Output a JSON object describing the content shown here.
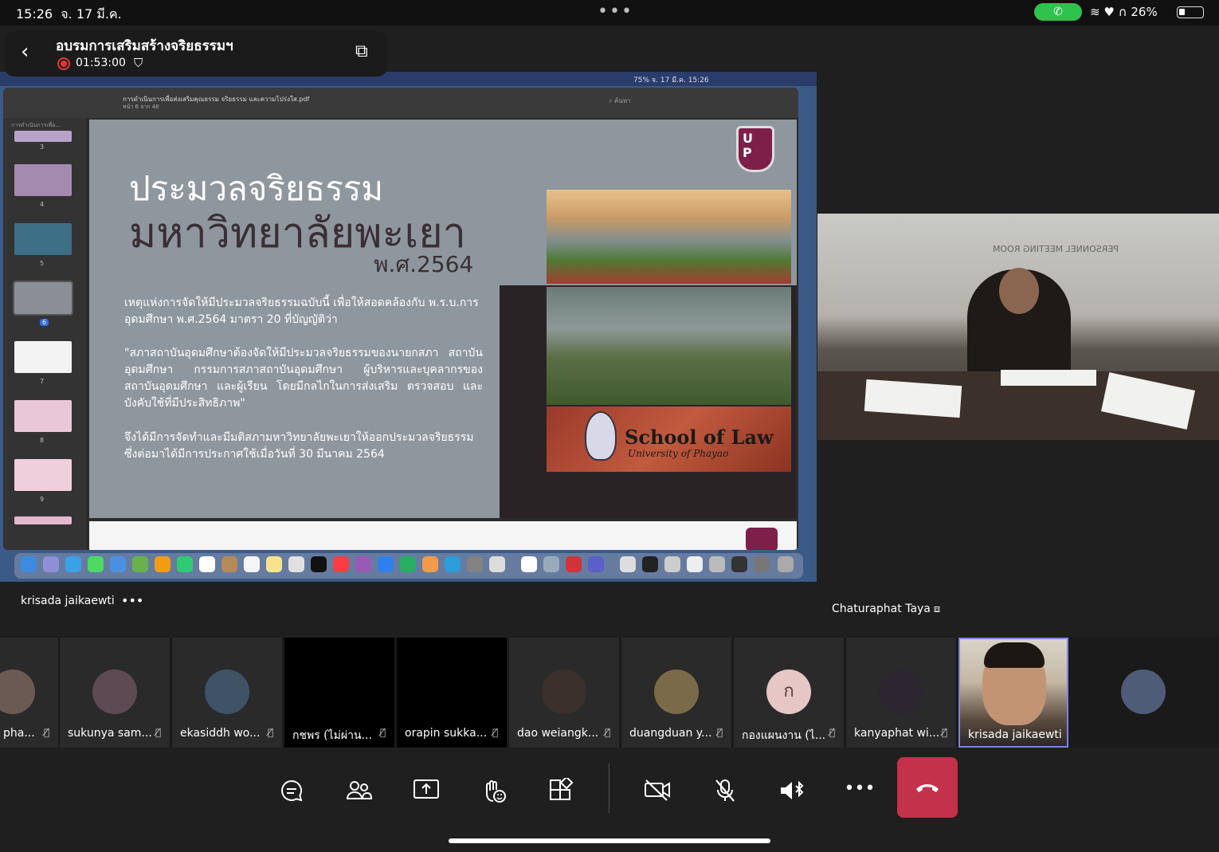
{
  "status_bar": {
    "time": "15:26",
    "date": "จ. 17 มี.ค.",
    "more": "•••",
    "call_icon": "phone-icon",
    "battery": "26%",
    "battery_level": 0.26
  },
  "meeting": {
    "title": "อบรมการเสริมสร้างจริยธรรมฯ",
    "recording_duration": "01:53:00"
  },
  "shared_screen": {
    "mac_menu_clock": "75%   จ. 17 มี.ค. 15:26",
    "pdf_filename": "การดำเนินการเพื่อส่งเสริมคุณธรรม จริยธรรม และความโปร่งใส.pdf",
    "pdf_page": "หน้า 6 จาก 48",
    "search_placeholder": "ค้นหา",
    "thumbnail_header": "การดำเนินการเพื่อ...",
    "thumb_pages": [
      "3",
      "4",
      "5",
      "6",
      "7",
      "8",
      "9"
    ],
    "selected_page": "6",
    "slide": {
      "heading_line1": "ประมวลจริยธรรม",
      "heading_line2": "มหาวิทยาลัยพะเยา",
      "heading_line3": "พ.ศ.2564",
      "paragraph1": "เหตุแห่งการจัดให้มีประมวลจริยธรรมฉบับนี้ เพื่อให้สอดคล้องกับ พ.ร.บ.การอุดมศึกษา พ.ศ.2564 มาตรา 20 ที่บัญญัติว่า",
      "paragraph2": "\"สภาสถาบันอุดมศึกษาต้องจัดให้มีประมวลจริยธรรมของนายกสภา สถาบันอุดมศึกษา กรรมการสภาสถาบันอุดมศึกษา ผู้บริหารและบุคลากรของสถาบันอุดมศึกษา และผู้เรียน โดยมีกลไกในการส่งเสริม ตรวจสอบ และบังคับใช้ที่มีประสิทธิภาพ\"",
      "paragraph3": "จึงได้มีการจัดทำและมีมติสภามหาวิทยาลัยพะเยาให้ออกประมวลจริยธรรม ซึ่งต่อมาได้มีการประกาศใช้เมื่อวันที่ 30 มีนาคม 2564",
      "school_name": "School of Law",
      "university": "University of Phayao"
    }
  },
  "presenter_name": "krisada jaikaewti",
  "main_video": {
    "name": "Chaturaphat Taya",
    "sign_text": "PERSONNEL MEETING ROOM"
  },
  "participants": [
    {
      "name": "pha...",
      "avatar_color": "#6b5a54"
    },
    {
      "name": "sukunya sam...",
      "avatar_color": "#5d4a52"
    },
    {
      "name": "ekasiddh wo...",
      "avatar_color": "#3f5266"
    },
    {
      "name": "กชพร (ไม่ผ่าน...",
      "avatar_color": ""
    },
    {
      "name": "orapin sukka...",
      "avatar_color": ""
    },
    {
      "name": "dao weiangk...",
      "avatar_color": "#3b2f2b"
    },
    {
      "name": "duangduan y...",
      "avatar_color": "#7a6a4a"
    },
    {
      "name": "กองแผนงาน (ไ...",
      "avatar_color": "#e7c6c6",
      "initial": "ก"
    },
    {
      "name": "kanyaphat wi...",
      "avatar_color": "#2b2630"
    }
  ],
  "self": {
    "name": "krisada jaikaewti"
  },
  "extra_participant_color": "#4f5c78",
  "colors": {
    "leave": "#c4314b",
    "active_border": "#7b83eb",
    "record": "#e53935",
    "call_pill": "#2fc34d"
  }
}
